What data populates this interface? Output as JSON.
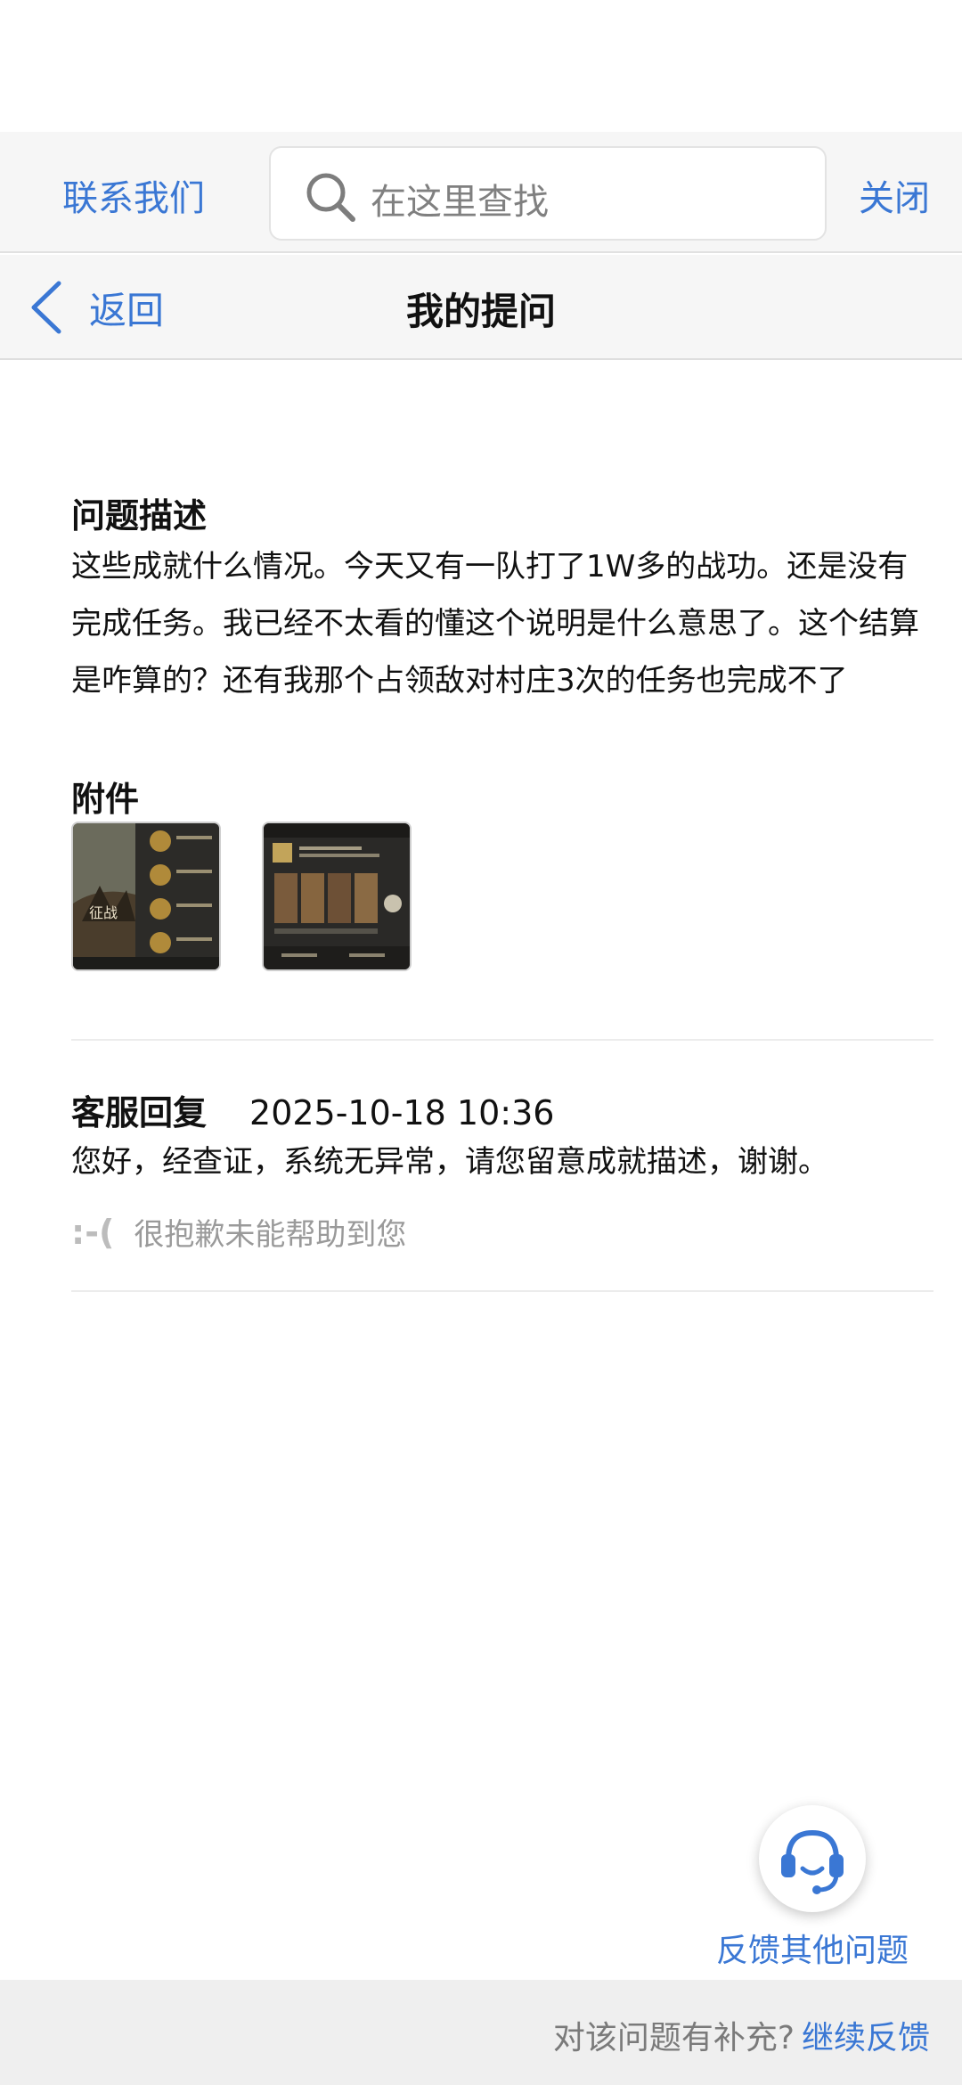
{
  "topbar": {
    "contact_label": "联系我们",
    "search_placeholder": "在这里查找",
    "close_label": "关闭"
  },
  "nav": {
    "back_label": "返回",
    "title": "我的提问"
  },
  "question": {
    "desc_title": "问题描述",
    "desc_text": "这些成就什么情况。今天又有一队打了1W多的战功。还是没有完成任务。我已经不太看的懂这个说明是什么意思了。这个结算是咋算的？还有我那个占领敌对村庄3次的任务也完成不了",
    "attach_title": "附件",
    "attachments": [
      {
        "name": "screenshot-1",
        "caption": "征战"
      },
      {
        "name": "screenshot-2",
        "caption": ""
      }
    ]
  },
  "reply": {
    "label": "客服回复",
    "time": "2025-10-18 10:36",
    "text": "您好，经查证，系统无异常，请您留意成就描述，谢谢。",
    "face": ":-(",
    "sorry": "很抱歉未能帮助到您"
  },
  "fab": {
    "icon": "headset-icon",
    "label": "反馈其他问题"
  },
  "bottom": {
    "prompt": "对该问题有补充?",
    "link": "继续反馈"
  },
  "colors": {
    "accent": "#3a77d4",
    "bar_bg": "#f6f6f6"
  }
}
